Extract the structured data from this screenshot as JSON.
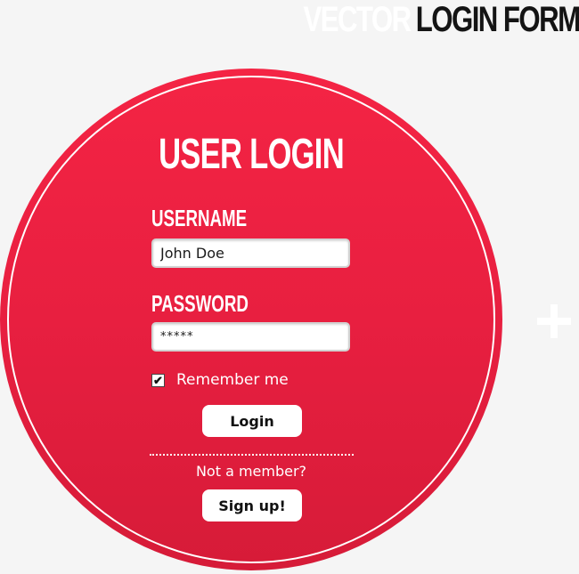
{
  "page": {
    "heading_light": "VECTOR",
    "heading_dark": "LOGIN FORM"
  },
  "login_form": {
    "title": "USER LOGIN",
    "username_label": "USERNAME",
    "username_value": "John Doe",
    "password_label": "PASSWORD",
    "password_value": "*****",
    "remember_checked": true,
    "remember_label": "Remember me",
    "login_button": "Login",
    "signup_prompt": "Not a member?",
    "signup_button": "Sign up!"
  },
  "colors": {
    "background": "#f5f5f5",
    "circle": "#e81f40",
    "text_on_circle": "#ffffff",
    "heading_dark": "#141414"
  },
  "icons": {
    "checkbox_mark": "checkmark-icon",
    "decoration": "plus-icon"
  }
}
